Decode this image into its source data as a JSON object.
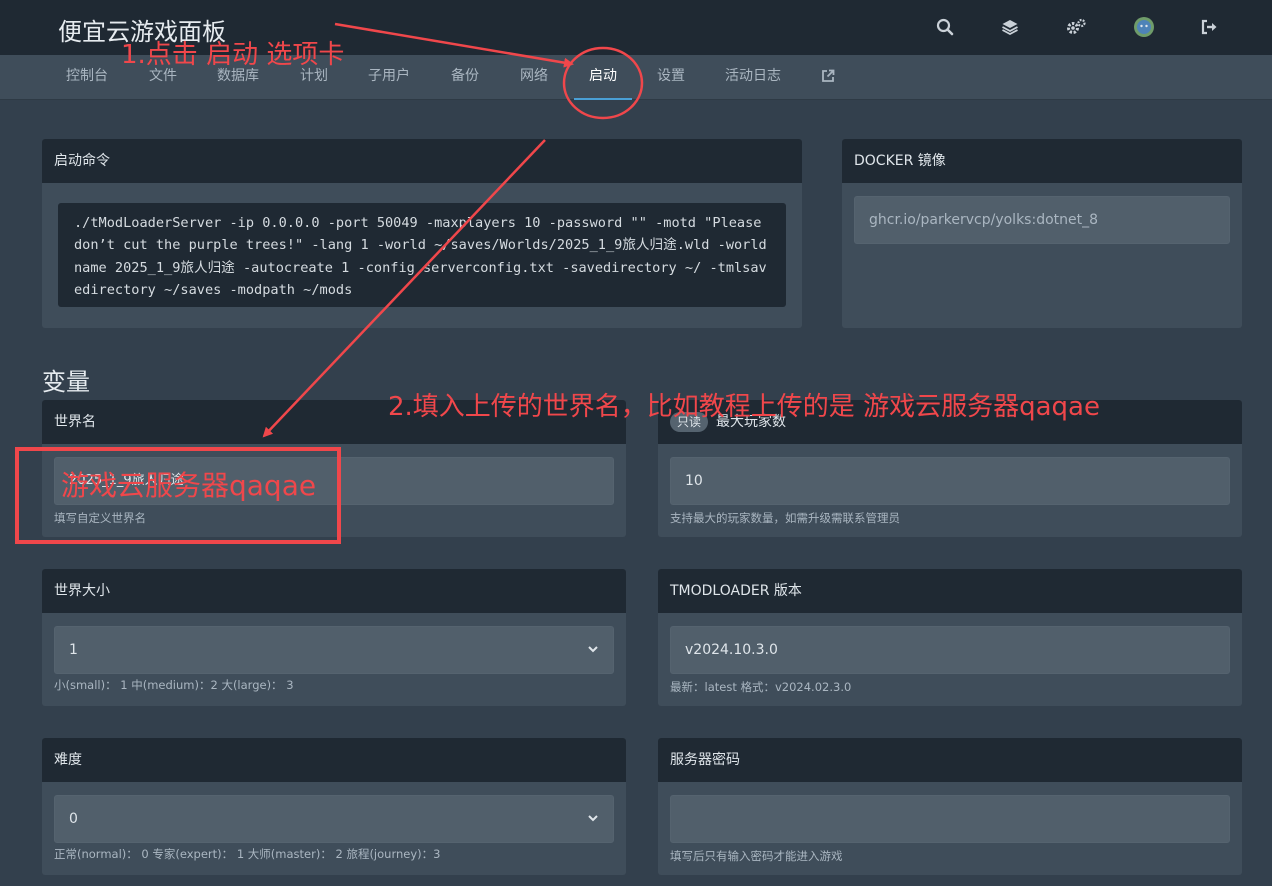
{
  "header": {
    "brand": "便宜云游戏面板",
    "icons": [
      "search-icon",
      "layers-icon",
      "cogs-icon",
      "avatar",
      "logout-icon"
    ]
  },
  "nav": {
    "tabs": [
      {
        "label": "控制台"
      },
      {
        "label": "文件"
      },
      {
        "label": "数据库"
      },
      {
        "label": "计划"
      },
      {
        "label": "子用户"
      },
      {
        "label": "备份"
      },
      {
        "label": "网络"
      },
      {
        "label": "启动",
        "active": true
      },
      {
        "label": "设置"
      },
      {
        "label": "活动日志"
      }
    ],
    "external_icon": "external-link-icon"
  },
  "startup": {
    "title": "启动命令",
    "command": "./tModLoaderServer -ip 0.0.0.0 -port 50049 -maxplayers 10 -password \"\" -motd \"Please don’t cut the purple trees!\" -lang 1 -world ~/saves/Worlds/2025_1_9旅人归途.wld -worldname 2025_1_9旅人归途 -autocreate 1 -config serverconfig.txt -savedirectory ~/ -tmlsavedirectory ~/saves -modpath ~/mods"
  },
  "docker": {
    "title": "DOCKER 镜像",
    "image": "ghcr.io/parkervcp/yolks:dotnet_8"
  },
  "variables": {
    "title": "变量",
    "world_name": {
      "label": "世界名",
      "value": "2025_1_9旅人归途",
      "hint": "填写自定义世界名"
    },
    "max_players": {
      "badge": "只读",
      "label": "最大玩家数",
      "value": "10",
      "hint": "支持最大的玩家数量，如需升级需联系管理员"
    },
    "world_size": {
      "label": "世界大小",
      "value": "1",
      "hint": "小(small)： 1 中(medium)：2 大(large)： 3"
    },
    "tmod_version": {
      "label": "TMODLOADER 版本",
      "value": "v2024.10.3.0",
      "hint": "最新：latest 格式：v2024.02.3.0"
    },
    "difficulty": {
      "label": "难度",
      "value": "0",
      "hint": "正常(normal)： 0 专家(expert)： 1 大师(master)： 2 旅程(journey)：3"
    },
    "server_password": {
      "label": "服务器密码",
      "value": "",
      "hint": "填写后只有输入密码才能进入游戏"
    }
  },
  "annotations": {
    "step1": "1.点击 启动 选项卡",
    "step2": "2.填入上传的世界名，比如教程上传的是 游戏云服务器qaqae",
    "overlay_text": "游戏云服务器qaqae",
    "color": "#f0474b"
  }
}
